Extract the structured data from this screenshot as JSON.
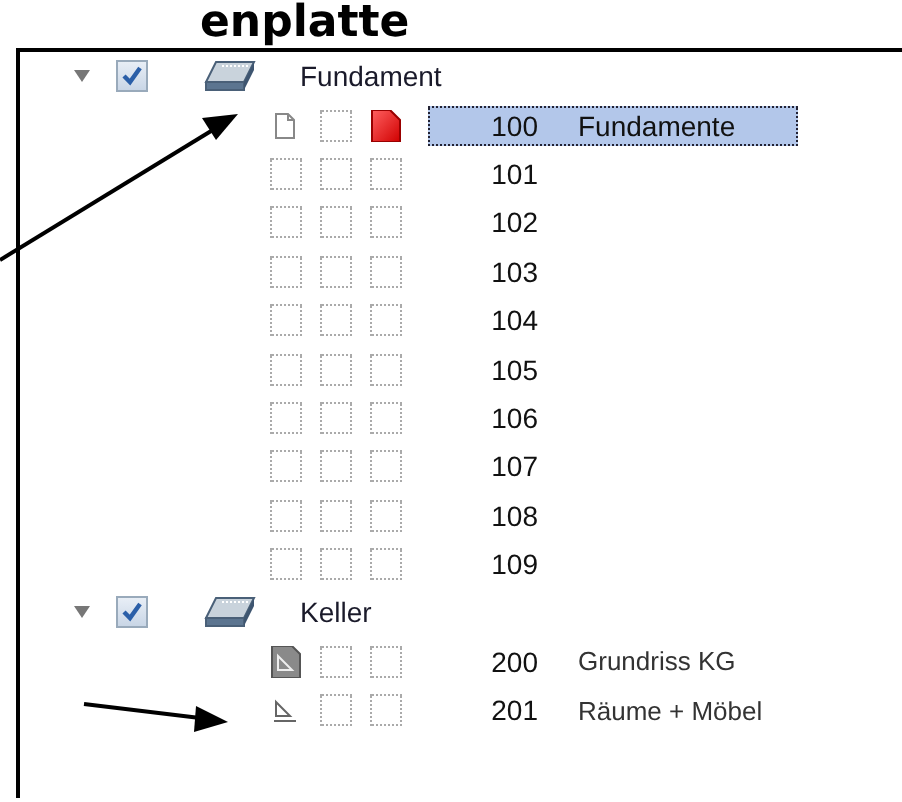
{
  "heading": "enplatte",
  "groups": [
    {
      "name": "Fundament",
      "expanded": true,
      "checked": true,
      "items": [
        {
          "number": "100",
          "name": "Fundamente",
          "selected": true,
          "slots": [
            {
              "kind": "page"
            },
            {
              "kind": "blank"
            },
            {
              "kind": "red-page"
            }
          ]
        },
        {
          "number": "101",
          "selected": false,
          "slots": [
            {
              "kind": "blank"
            },
            {
              "kind": "blank"
            },
            {
              "kind": "blank"
            }
          ]
        },
        {
          "number": "102",
          "selected": false,
          "slots": [
            {
              "kind": "blank"
            },
            {
              "kind": "blank"
            },
            {
              "kind": "blank"
            }
          ]
        },
        {
          "number": "103",
          "selected": false,
          "slots": [
            {
              "kind": "blank"
            },
            {
              "kind": "blank"
            },
            {
              "kind": "blank"
            }
          ]
        },
        {
          "number": "104",
          "selected": false,
          "slots": [
            {
              "kind": "blank"
            },
            {
              "kind": "blank"
            },
            {
              "kind": "blank"
            }
          ]
        },
        {
          "number": "105",
          "selected": false,
          "slots": [
            {
              "kind": "blank"
            },
            {
              "kind": "blank"
            },
            {
              "kind": "blank"
            }
          ]
        },
        {
          "number": "106",
          "selected": false,
          "slots": [
            {
              "kind": "blank"
            },
            {
              "kind": "blank"
            },
            {
              "kind": "blank"
            }
          ]
        },
        {
          "number": "107",
          "selected": false,
          "slots": [
            {
              "kind": "blank"
            },
            {
              "kind": "blank"
            },
            {
              "kind": "blank"
            }
          ]
        },
        {
          "number": "108",
          "selected": false,
          "slots": [
            {
              "kind": "blank"
            },
            {
              "kind": "blank"
            },
            {
              "kind": "blank"
            }
          ]
        },
        {
          "number": "109",
          "selected": false,
          "slots": [
            {
              "kind": "blank"
            },
            {
              "kind": "blank"
            },
            {
              "kind": "blank"
            }
          ]
        }
      ]
    },
    {
      "name": "Keller",
      "expanded": true,
      "checked": true,
      "items": [
        {
          "number": "200",
          "name": "Grundriss KG",
          "selected": false,
          "slots": [
            {
              "kind": "plan-dark"
            },
            {
              "kind": "blank"
            },
            {
              "kind": "blank"
            }
          ]
        },
        {
          "number": "201",
          "name": "Räume + Möbel",
          "selected": false,
          "slots": [
            {
              "kind": "plan"
            },
            {
              "kind": "blank"
            },
            {
              "kind": "blank"
            }
          ]
        }
      ]
    }
  ]
}
